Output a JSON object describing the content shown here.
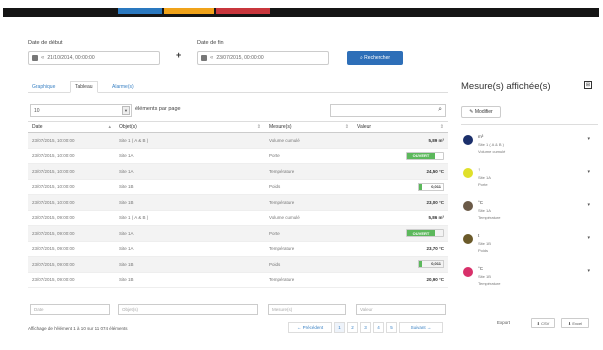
{
  "colors": {
    "top_bar": "#151515",
    "accent1": "#2a78bf",
    "accent2": "#f0a31a",
    "accent3": "#c8363c",
    "primary": "#2e6fb8"
  },
  "date_start": {
    "label": "Date de début",
    "value": "21/10/2014, 00:00:00"
  },
  "date_end": {
    "label": "Date de fin",
    "value": "23/07/2015, 00:00:00"
  },
  "search_button": "Rechercher",
  "tabs": [
    "Graphique",
    "Tableau",
    "Alarme(s)"
  ],
  "per_page": {
    "value": "10",
    "label": "éléments par page"
  },
  "table": {
    "headers": [
      "Date",
      "Objet(s)",
      "Mesure(s)",
      "Valeur"
    ],
    "rows": [
      {
        "date": "23/07/2015, 10:00:00",
        "obj": "Site 1 ( A & B )",
        "mesure": "Volume cumulé",
        "val": "5,89 m³",
        "kind": "text"
      },
      {
        "date": "23/07/2015, 10:00:00",
        "obj": "Site 1A",
        "mesure": "Porte",
        "val": "OUVERT",
        "kind": "toggle"
      },
      {
        "date": "23/07/2015, 10:00:00",
        "obj": "Site 1A",
        "mesure": "Température",
        "val": "24,50 °C",
        "kind": "text"
      },
      {
        "date": "23/07/2015, 10:00:00",
        "obj": "Site 1B",
        "mesure": "Poids",
        "val": "0,011",
        "kind": "bar"
      },
      {
        "date": "23/07/2015, 10:00:00",
        "obj": "Site 1B",
        "mesure": "Température",
        "val": "23,00 °C",
        "kind": "text"
      },
      {
        "date": "23/07/2015, 09:00:00",
        "obj": "Site 1 ( A & B )",
        "mesure": "Volume cumulé",
        "val": "5,86 m³",
        "kind": "text"
      },
      {
        "date": "23/07/2015, 09:00:00",
        "obj": "Site 1A",
        "mesure": "Porte",
        "val": "OUVERT",
        "kind": "toggle"
      },
      {
        "date": "23/07/2015, 09:00:00",
        "obj": "Site 1A",
        "mesure": "Température",
        "val": "23,70 °C",
        "kind": "text"
      },
      {
        "date": "23/07/2015, 09:00:00",
        "obj": "Site 1B",
        "mesure": "Poids",
        "val": "0,011",
        "kind": "bar"
      },
      {
        "date": "23/07/2015, 09:00:00",
        "obj": "Site 1B",
        "mesure": "Température",
        "val": "20,90 °C",
        "kind": "text"
      }
    ],
    "filters": [
      "Date",
      "Objet(s)",
      "Mesure(s)",
      "Valeur"
    ]
  },
  "info": "Affichage de l'élément 1 à 10 sur 11 074 éléments",
  "pagination": [
    "← Précédent",
    "1",
    "2",
    "3",
    "4",
    "5",
    "Suivant →"
  ],
  "panel": {
    "title": "Mesure(s) affichée(s)",
    "modify": "Modifier",
    "items": [
      {
        "color": "#1b2f6b",
        "l1": "m³",
        "l2": "Site 1 ( A & B )",
        "l3": "Volume cumulé"
      },
      {
        "color": "#e0e02a",
        "l1": "↑",
        "l2": "Site 1A",
        "l3": "Porte"
      },
      {
        "color": "#6b5a48",
        "l1": "°C",
        "l2": "Site 1A",
        "l3": "Température"
      },
      {
        "color": "#6b5a2a",
        "l1": "t",
        "l2": "Site 1B",
        "l3": "Poids"
      },
      {
        "color": "#d8306a",
        "l1": "°C",
        "l2": "Site 1B",
        "l3": "Température"
      }
    ]
  },
  "export": {
    "label": "Export",
    "csv": "CSV",
    "excel": "Excel"
  }
}
